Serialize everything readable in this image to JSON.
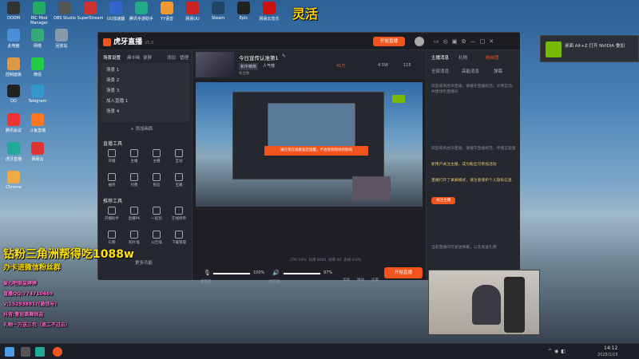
{
  "desktop": {
    "icons": [
      {
        "label": "DOOM",
        "color": "#333"
      },
      {
        "label": "IRC Mod Manager",
        "color": "#2a6"
      },
      {
        "label": "OBS Studio",
        "color": "#444"
      },
      {
        "label": "SuperStream",
        "color": "#c33"
      },
      {
        "label": "UU加速器",
        "color": "#36c"
      },
      {
        "label": "腾讯手游助手",
        "color": "#2a8"
      },
      {
        "label": "YY语音",
        "color": "#e93"
      },
      {
        "label": "网易UU",
        "color": "#c22"
      },
      {
        "label": "Steam",
        "color": "#246"
      },
      {
        "label": "Epic",
        "color": "#222"
      },
      {
        "label": "网易云音乐",
        "color": "#c11"
      }
    ],
    "left_icons": [
      {
        "label": "此电脑",
        "color": "#4a8fd8"
      },
      {
        "label": "网络",
        "color": "#3a7"
      },
      {
        "label": "回收站",
        "color": "#89a"
      },
      {
        "label": "控制面板",
        "color": "#d94"
      },
      {
        "label": "微信",
        "color": "#2c4"
      },
      {
        "label": "QQ",
        "color": "#222"
      },
      {
        "label": "Telegram",
        "color": "#39c"
      },
      {
        "label": "腾讯会议",
        "color": "#e33"
      },
      {
        "label": "斗鱼直播",
        "color": "#f72"
      },
      {
        "label": "虎牙直播",
        "color": "#2a9"
      },
      {
        "label": "网易云",
        "color": "#d33"
      },
      {
        "label": "Chrome",
        "color": "#ea4"
      }
    ],
    "overlay_logo": "灵活"
  },
  "app": {
    "logo": "虎牙直播",
    "version": "v5.0",
    "start_live_button": "开始直播",
    "title": {
      "room_title": "今日宣传认准第1",
      "tag_1": "和平精英",
      "tag_2": "人气榜",
      "fans": "粉丝数",
      "online": "41万",
      "stat_1": "4.5W",
      "stat_2": "115"
    },
    "left": {
      "scene_tab": "场景设置",
      "scene_tab_2": "画中画",
      "scene_tab_3": "录屏",
      "add_label": "添加",
      "edit_label": "管理",
      "scenes": [
        "场景 1",
        "场景 2",
        "场景 3",
        "加入直播 1",
        "场景 4"
      ],
      "add_scene_button": "+ 添加画面",
      "tools_title": "直播工具",
      "tools": [
        {
          "label": "开播"
        },
        {
          "label": "主播"
        },
        {
          "label": "主播"
        },
        {
          "label": "互动"
        },
        {
          "label": "抽奖"
        },
        {
          "label": "付费"
        },
        {
          "label": "粉丝"
        },
        {
          "label": "宝箱"
        }
      ],
      "tools2_title": "推荐工具",
      "tools2": [
        {
          "label": "开播助手"
        },
        {
          "label": "直播PK"
        },
        {
          "label": "一起玩"
        },
        {
          "label": "在线榜单"
        },
        {
          "label": "礼物"
        },
        {
          "label": "照片墙"
        },
        {
          "label": "公告墙"
        },
        {
          "label": "下载管理"
        }
      ],
      "more_tools": "更多功能"
    },
    "center": {
      "notice_bar": "请在现在观看鉴定提醒，不会受到现场的影响",
      "mic_label": "麦克风",
      "mic_value": "100%",
      "speaker_label": "扬声器",
      "speaker_value": "97%",
      "effect_label": "美颜",
      "sticker_label": "特效",
      "more_label": "设置",
      "start_button": "开始直播",
      "status": [
        {
          "label": "CPU",
          "value": "19%"
        },
        {
          "label": "码率",
          "value": "8000"
        },
        {
          "label": "帧率",
          "value": "60"
        },
        {
          "label": "丢帧",
          "value": "0.0%"
        }
      ]
    },
    "right": {
      "tab_chat": "主播消息",
      "tab_gift": "礼物",
      "tab_active": "粉丝团",
      "sub_tab_1": "全部消息",
      "sub_tab_2": "高能消息",
      "sub_tab_3": "弹幕",
      "msg_1": "欢迎来到虎牙直播，请遵守直播规范，文明互动，共建绿色直播间",
      "msg_2": "欢迎来到虎牙直播，请遵守直播规范，传播正能量",
      "msg_3": "新用户关注主播，成为粉丝可参加活动",
      "msg_4": "直播打开了录屏模式，请注意保护个人隐私信息",
      "msg_btn": "关注主播",
      "msg_5": "当前直播间可发送弹幕，以及发送礼物"
    }
  },
  "stream_overlay": {
    "headline": "钻粉三角洲帮得吃1088w",
    "subline": "办卡进微信粉丝群",
    "lines": [
      "爱心吧很盐婷婷",
      "直播QQ:774710469",
      "V:15293891?(微信号)",
      "抖音:鲁班跳舞很盐",
      "礼物一万送三包（逐二不过云）"
    ]
  },
  "notification": {
    "text": "桌面 Alt+Z 打开 NVIDIA 叠加"
  },
  "taskbar": {
    "time": "14:12",
    "date": "2025/1/15"
  },
  "colors": {
    "accent": "#f2541e",
    "nvidia": "#76b900"
  }
}
